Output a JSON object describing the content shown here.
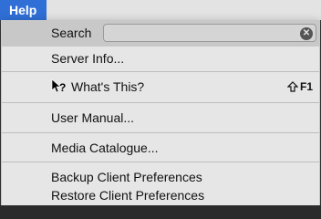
{
  "menubar": {
    "title": "Help"
  },
  "search": {
    "label": "Search",
    "value": "",
    "placeholder": ""
  },
  "items": {
    "server_info": "Server Info...",
    "whats_this": "What's This?",
    "whats_this_shortcut": "F1",
    "user_manual": "User Manual...",
    "media_catalogue": "Media Catalogue...",
    "backup": "Backup Client Preferences",
    "restore": "Restore Client Preferences"
  },
  "colors": {
    "menubar_highlight": "#2f6fd6",
    "menu_bg": "#e6e6e6",
    "search_row_bg": "#c8c8c8"
  }
}
